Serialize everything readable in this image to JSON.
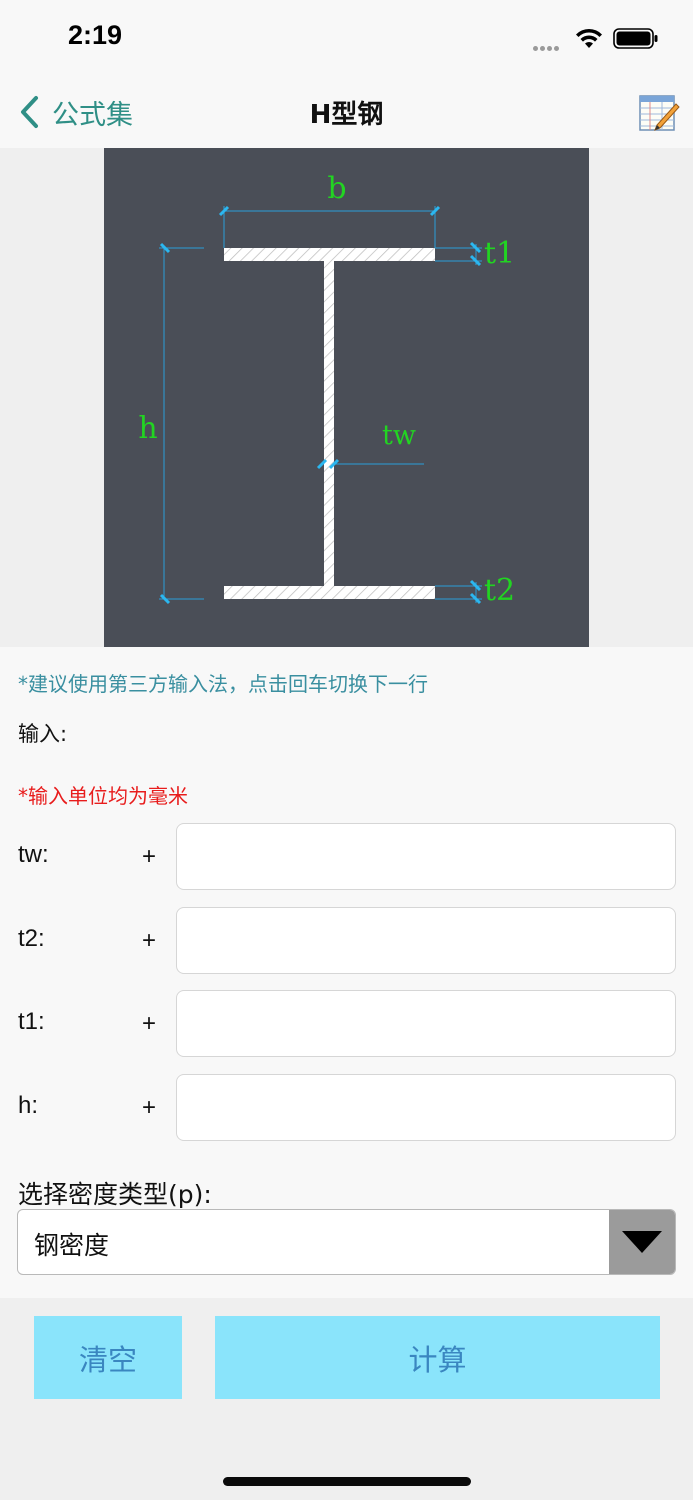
{
  "status": {
    "time": "2:19"
  },
  "nav": {
    "back_label": "公式集",
    "title": "H型钢",
    "notes_icon": "notes-edit-icon"
  },
  "diagram": {
    "label_b": "b",
    "label_h": "h",
    "label_t1": "t1",
    "label_t2": "t2",
    "label_tw": "tw",
    "line_color": "#2b9fd8",
    "label_color": "#22d422"
  },
  "form": {
    "hint": "*建议使用第三方输入法，点击回车切换下一行",
    "input_title": "输入:",
    "unit_note": "*输入单位均为毫米",
    "params": [
      {
        "label": "tw:",
        "sign": "+",
        "value": ""
      },
      {
        "label": "t2:",
        "sign": "+",
        "value": ""
      },
      {
        "label": "t1:",
        "sign": "+",
        "value": ""
      },
      {
        "label": "h:",
        "sign": "+",
        "value": ""
      }
    ],
    "density_label": "选择密度类型(p):",
    "density_value": "钢密度"
  },
  "actions": {
    "clear_label": "清空",
    "calc_label": "计算"
  },
  "colors": {
    "accent": "#2f8f86",
    "button_bg": "#8ae4fb",
    "button_text": "#3a86c0",
    "note_red": "#e81c1c"
  }
}
